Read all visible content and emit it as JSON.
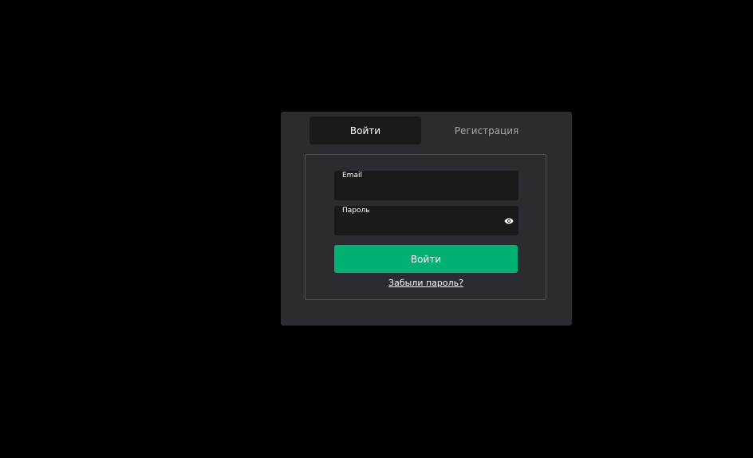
{
  "tabs": {
    "login_label": "Войти",
    "register_label": "Регистрация"
  },
  "form": {
    "email_label": "Email",
    "email_value": "",
    "password_label": "Пароль",
    "password_value": "",
    "password_toggle_icon": "eye-icon",
    "submit_label": "Войти",
    "forgot_label": "Забыли пароль?"
  },
  "colors": {
    "background": "#000000",
    "modal": "#2b2c30",
    "field": "#1a1a1a",
    "accent": "#00b173",
    "inactive_tab_text": "#a6a7ab"
  }
}
